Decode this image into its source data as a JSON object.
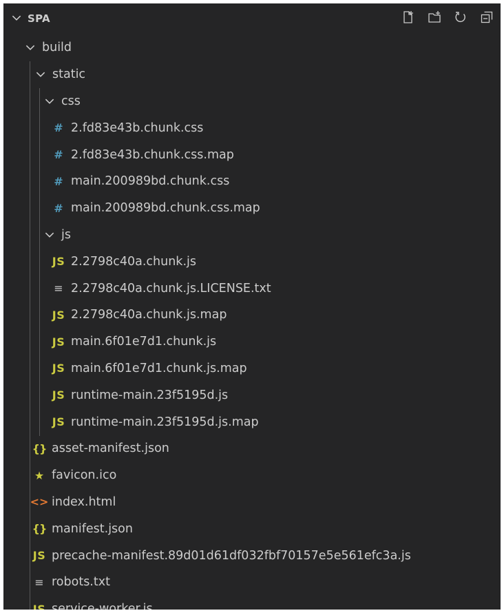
{
  "header": {
    "title": "SPA"
  },
  "icons": {
    "css": "#",
    "js": "JS",
    "json": "{}",
    "html": "<>",
    "star": "★",
    "txt": "≡"
  },
  "tree": {
    "build": "build",
    "static": "static",
    "css": "css",
    "css_files": [
      "2.fd83e43b.chunk.css",
      "2.fd83e43b.chunk.css.map",
      "main.200989bd.chunk.css",
      "main.200989bd.chunk.css.map"
    ],
    "js": "js",
    "js_files": [
      "2.2798c40a.chunk.js",
      "2.2798c40a.chunk.js.LICENSE.txt",
      "2.2798c40a.chunk.js.map",
      "main.6f01e7d1.chunk.js",
      "main.6f01e7d1.chunk.js.map",
      "runtime-main.23f5195d.js",
      "runtime-main.23f5195d.js.map"
    ],
    "build_files": [
      "asset-manifest.json",
      "favicon.ico",
      "index.html",
      "manifest.json",
      "precache-manifest.89d01d61df032fbf70157e5e561efc3a.js",
      "robots.txt",
      "service-worker.js"
    ]
  },
  "colors": {
    "background": "#252526",
    "text": "#cccccc",
    "css_icon": "#519aba",
    "js_icon": "#cbcb41",
    "html_icon": "#e37933"
  }
}
